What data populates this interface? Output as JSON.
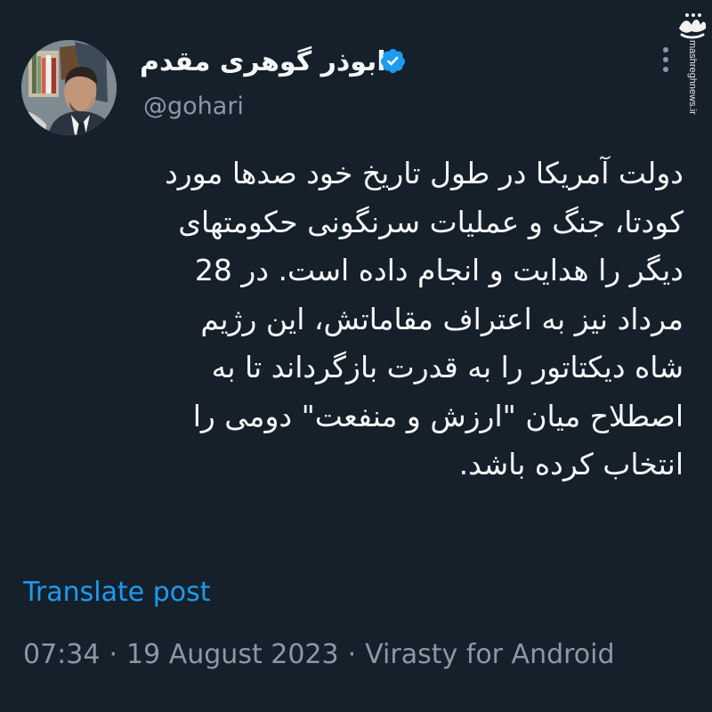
{
  "author": {
    "display_name": "ابوذر گوهری مقدم",
    "handle": "@gohari",
    "verified": true,
    "avatar_icon": "profile-photo"
  },
  "watermark": {
    "logo_text": "مشرق",
    "url": "mashreghnews.ir"
  },
  "post": {
    "text": "دولت آمریکا در طول تاریخ خود صدها مورد\nکودتا، جنگ و عملیات سرنگونی حکومتهای\nدیگر را هدایت و انجام داده است. در 28\nمرداد نیز به اعتراف مقاماتش، این رژیم\nشاه دیکتاتور را به قدرت بازگرداند تا به\nاصطلاح میان \"ارزش و منفعت\" دومی را\nانتخاب کرده باشد."
  },
  "translate_label": "Translate post",
  "meta": {
    "time": "07:34",
    "separator": "·",
    "date": "19 August 2023",
    "source": "Virasty for Android"
  },
  "colors": {
    "background": "#15202b",
    "text": "#e7e9ea",
    "secondary": "#8b98a5",
    "accent": "#1d9bf0"
  },
  "icons": {
    "verified": "verified-badge-icon",
    "more": "more-options-icon"
  }
}
